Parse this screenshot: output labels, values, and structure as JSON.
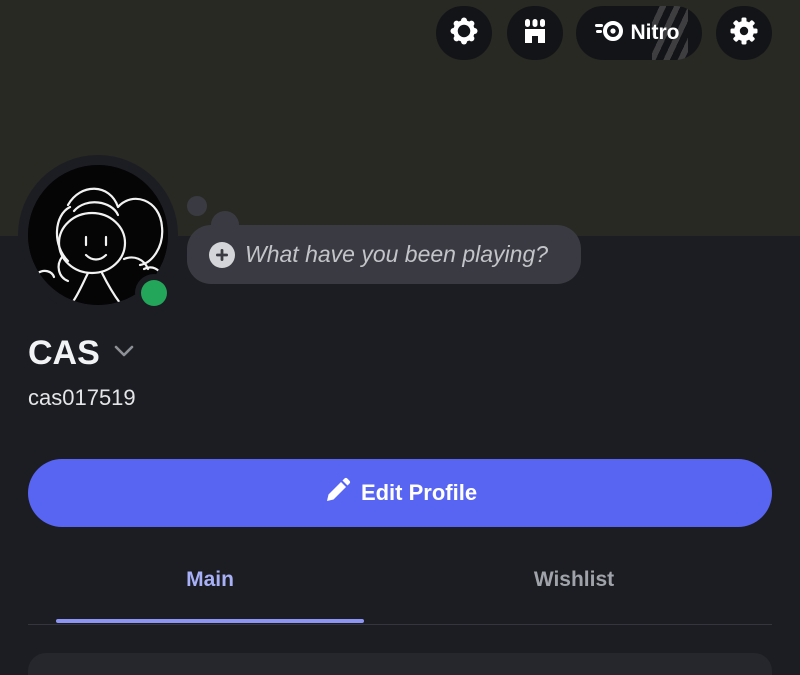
{
  "header": {
    "buttons": [
      {
        "name": "quests-icon"
      },
      {
        "name": "shop-icon"
      },
      {
        "name": "nitro-icon"
      },
      {
        "name": "gear-icon"
      }
    ],
    "nitro_label": "Nitro"
  },
  "profile": {
    "display_name": "CAS",
    "username": "cas017519",
    "status_color": "#23a55a",
    "activity_placeholder": "What have you been playing?"
  },
  "actions": {
    "edit_profile_label": "Edit Profile",
    "accent": "#5865f2"
  },
  "tabs": [
    {
      "label": "Main",
      "active": true
    },
    {
      "label": "Wishlist",
      "active": false
    }
  ]
}
